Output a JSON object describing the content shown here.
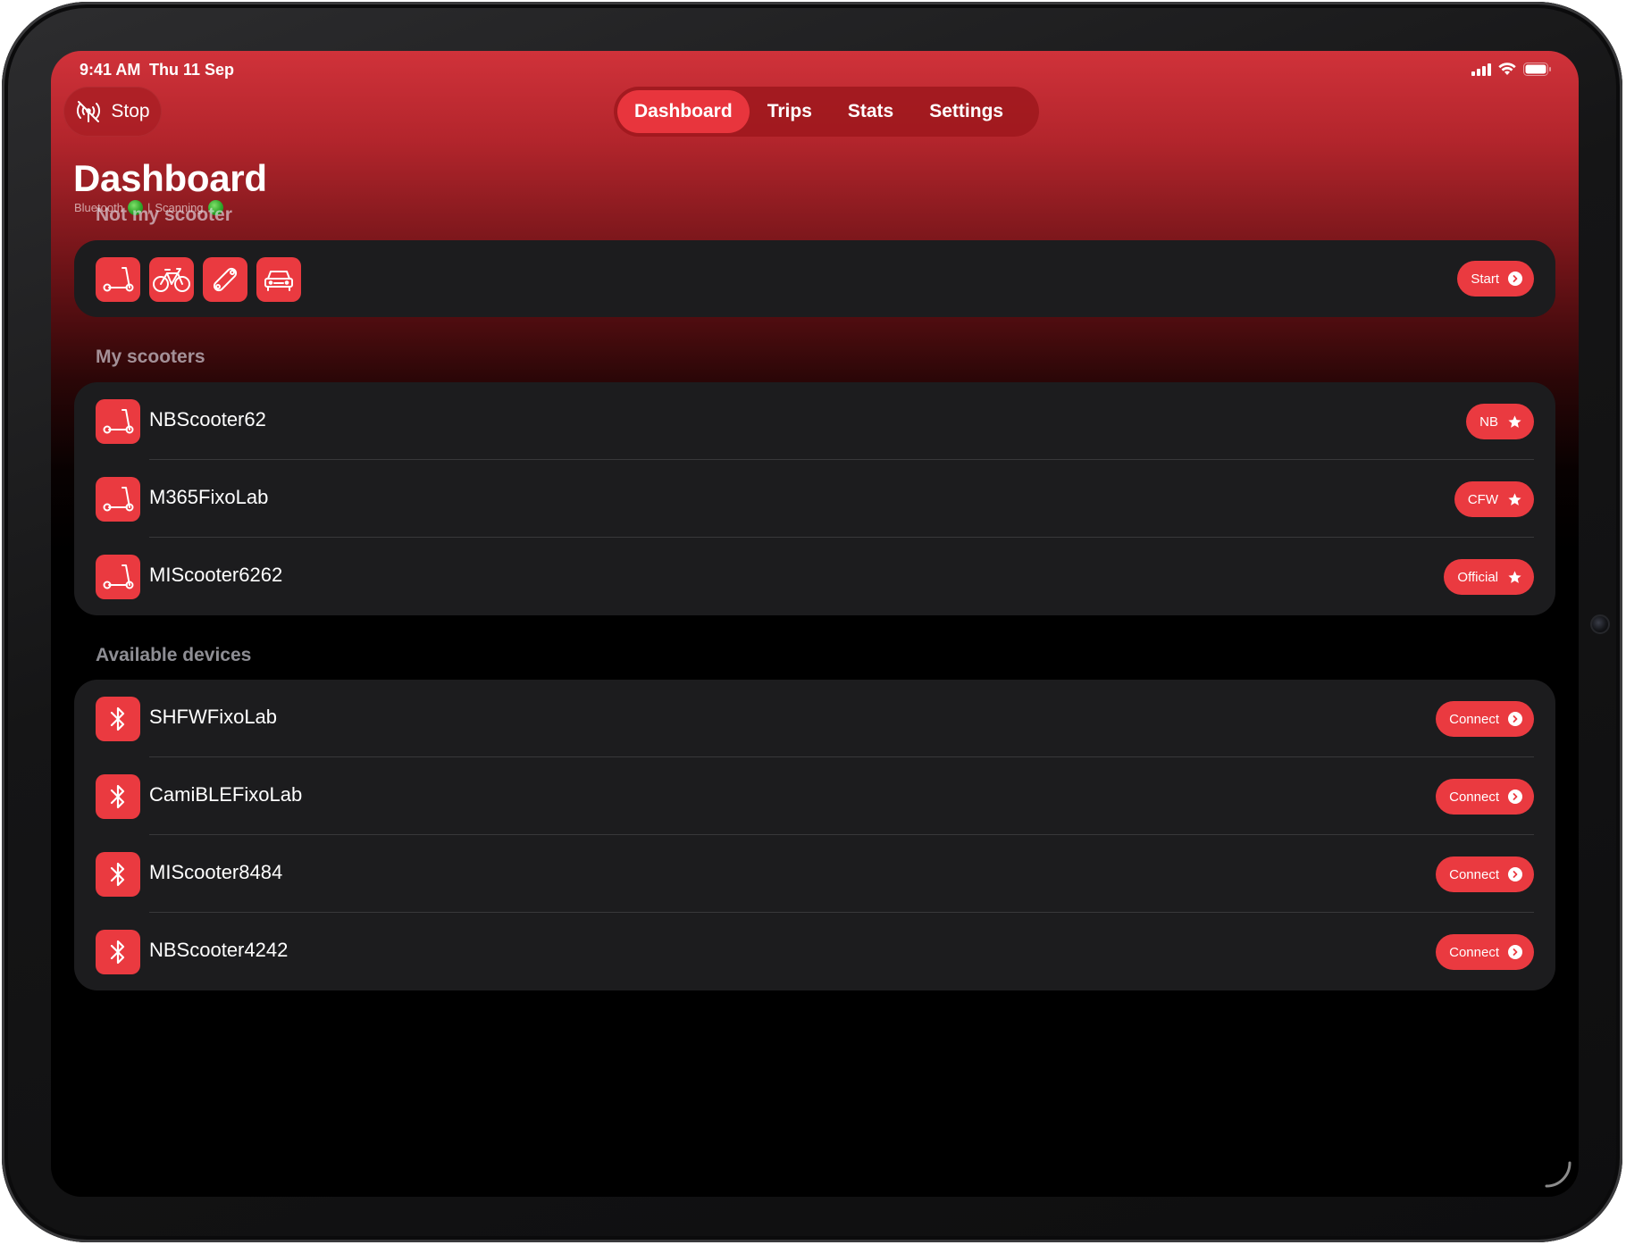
{
  "status_bar": {
    "time": "9:41 AM",
    "date": "Thu 11 Sep"
  },
  "toolbar": {
    "stop_label": "Stop"
  },
  "tabs": [
    {
      "label": "Dashboard",
      "active": true
    },
    {
      "label": "Trips",
      "active": false
    },
    {
      "label": "Stats",
      "active": false
    },
    {
      "label": "Settings",
      "active": false
    }
  ],
  "page": {
    "title": "Dashboard",
    "bluetooth_label": "Bluetooth",
    "separator": "|",
    "scanning_label": "Scanning"
  },
  "not_my_scooter": {
    "header": "Not my scooter",
    "vehicle_icons": [
      "scooter-icon",
      "bicycle-icon",
      "skateboard-icon",
      "car-icon"
    ],
    "start_label": "Start"
  },
  "my_scooters": {
    "header": "My scooters",
    "items": [
      {
        "name": "NBScooter62",
        "badge": "NB"
      },
      {
        "name": "M365FixoLab",
        "badge": "CFW"
      },
      {
        "name": "MIScooter6262",
        "badge": "Official"
      }
    ]
  },
  "available_devices": {
    "header": "Available devices",
    "items": [
      {
        "name": "SHFWFixoLab",
        "action": "Connect"
      },
      {
        "name": "CamiBLEFixoLab",
        "action": "Connect"
      },
      {
        "name": "MIScooter8484",
        "action": "Connect"
      },
      {
        "name": "NBScooter4242",
        "action": "Connect"
      }
    ]
  },
  "colors": {
    "accent": "#ea3a40",
    "card": "#1c1c1e",
    "status_ok": "#2fa52a"
  }
}
